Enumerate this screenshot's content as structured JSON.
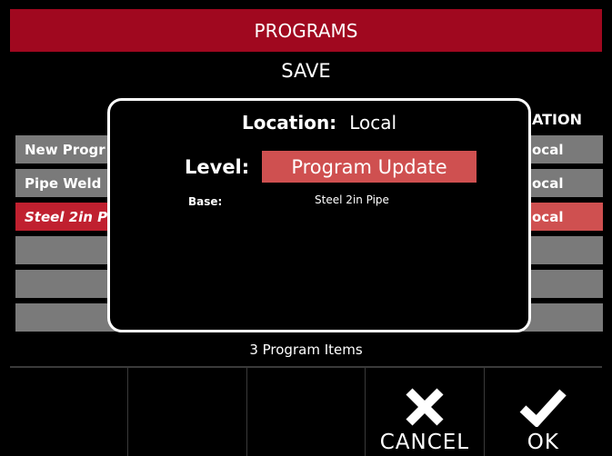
{
  "header": {
    "title": "PROGRAMS"
  },
  "screen": {
    "subtitle": "SAVE",
    "location_column_header": "ATION"
  },
  "program_list": [
    {
      "name": "New Progr",
      "location": "ocal"
    },
    {
      "name": "Pipe Weld",
      "location": "ocal"
    },
    {
      "name": "Steel 2in P",
      "location": "ocal"
    },
    {
      "name": "",
      "location": ""
    },
    {
      "name": "",
      "location": ""
    },
    {
      "name": "",
      "location": ""
    }
  ],
  "footer": {
    "count_text": "3 Program Items"
  },
  "dialog": {
    "location_label": "Location:",
    "location_value": "Local",
    "level_label": "Level:",
    "level_value": "Program Update",
    "base_label": "Base:",
    "base_value": "Steel 2in Pipe"
  },
  "buttons": {
    "cancel": "CANCEL",
    "ok": "OK"
  },
  "colors": {
    "title_bar": "#a0081f",
    "selected_row": "#c0202f",
    "level_highlight": "#cf5050",
    "row": "#7a7a7a"
  }
}
